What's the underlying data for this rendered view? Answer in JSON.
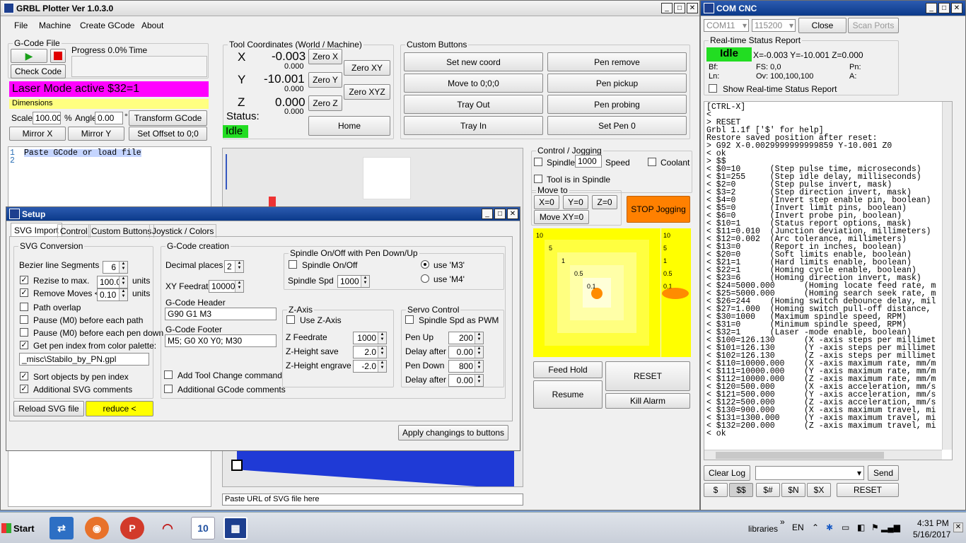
{
  "main": {
    "title": "GRBL Plotter Ver 1.0.3.0",
    "menu": [
      "File",
      "Machine",
      "Create GCode",
      "About"
    ],
    "gcode_file": {
      "label": "G-Code File",
      "progress": "Progress 0.0%",
      "time": "Time",
      "check_code": "Check Code"
    },
    "laser_mode": "Laser Mode active $32=1",
    "dimensions": "Dimensions",
    "scale_label": "Scale",
    "scale_value": "100.00",
    "percent": "%",
    "angle_label": "Angle",
    "angle_value": "0.00",
    "degree": "°",
    "transform": "Transform GCode",
    "mirror_x": "Mirror X",
    "mirror_y": "Mirror Y",
    "set_offset": "Set Offset to 0;0",
    "editor_line1": "Paste GCode or load file",
    "line_nums": [
      "1",
      "2"
    ],
    "tool_coords": {
      "label": "Tool Coordinates (World / Machine)",
      "x": "X",
      "x_world": "-0.003",
      "x_machine": "0.000",
      "y": "Y",
      "y_world": "-10.001",
      "y_machine": "0.000",
      "z": "Z",
      "z_world": "0.000",
      "z_machine": "0.000",
      "status_label": "Status:",
      "status": "Idle",
      "zero_x": "Zero X",
      "zero_y": "Zero Y",
      "zero_z": "Zero Z",
      "zero_xy": "Zero XY",
      "zero_xyz": "Zero XYZ",
      "home": "Home"
    },
    "custom_buttons": {
      "label": "Custom Buttons",
      "buttons": [
        "Set new coord",
        "Pen remove",
        "Move to 0;0;0",
        "Pen pickup",
        "Tray Out",
        "Pen probing",
        "Tray In",
        "Set Pen 0"
      ]
    },
    "control": {
      "label": "Control / Jogging",
      "spindle": "Spindle",
      "speed_value": "1000",
      "speed_label": "Speed",
      "coolant": "Coolant",
      "tool_in_spindle": "Tool is in Spindle",
      "move_to": "Move to",
      "x0": "X=0",
      "y0": "Y=0",
      "z0": "Z=0",
      "move_xy0": "Move XY=0",
      "stop_jogging": "STOP Jogging"
    },
    "jog_labels": [
      "10",
      "5",
      "1",
      "0.5",
      "0.1"
    ],
    "jog_z_labels": [
      "10",
      "5",
      "1",
      "0.5",
      "0.1"
    ],
    "feed_hold": "Feed Hold",
    "resume": "Resume",
    "reset": "RESET",
    "kill_alarm": "Kill Alarm",
    "url_placeholder": "Paste URL of SVG file here"
  },
  "setup": {
    "title": "Setup",
    "tabs": [
      "SVG Import",
      "Control",
      "Custom Buttons",
      "Joystick / Colors"
    ],
    "svg_conversion": "SVG Conversion",
    "bezier": "Bezier line Segments",
    "bezier_value": "6",
    "resize": "Rezise to max.",
    "resize_value": "100.0",
    "units": "units",
    "remove_moves": "Remove Moves <",
    "remove_value": "0.10",
    "path_overlap": "Path overlap",
    "pause_path": "Pause (M0) before each path",
    "pause_pen": "Pause (M0) before each pen down",
    "pen_index": "Get pen index from color palette:",
    "palette_file": "_misc\\Stabilo_by_PN.gpl",
    "sort": "Sort objects by pen index",
    "additional_svg": "Additional SVG comments",
    "gcode_creation": "G-Code creation",
    "decimal": "Decimal places",
    "decimal_value": "2",
    "xy_feed": "XY Feedrate",
    "xy_feed_value": "10000",
    "header_label": "G-Code Header",
    "header_value": "G90 G1 M3",
    "footer_label": "G-Code Footer",
    "footer_value": "M5; G0 X0 Y0; M30",
    "tool_change": "Add Tool Change command",
    "additional_gcode": "Additional GCode comments",
    "spindle_onoff_group": "Spindle On/Off with Pen Down/Up",
    "spindle_onoff": "Spindle On/Off",
    "spindle_spd": "Spindle Spd",
    "spindle_spd_value": "1000",
    "use_m3": "use 'M3'",
    "use_m4": "use 'M4'",
    "z_axis": "Z-Axis",
    "use_z": "Use Z-Axis",
    "z_feed": "Z Feedrate",
    "z_feed_value": "1000",
    "z_save": "Z-Height save",
    "z_save_value": "2.0",
    "z_engrave": "Z-Height engrave",
    "z_engrave_value": "-2.0",
    "servo": "Servo Control",
    "spindle_pwm": "Spindle Spd as PWM",
    "pen_up": "Pen Up",
    "pen_up_value": "200",
    "delay1": "Delay after",
    "delay1_value": "0.00",
    "pen_down": "Pen Down",
    "pen_down_value": "800",
    "delay2": "Delay after",
    "delay2_value": "0.00",
    "reload": "Reload SVG file",
    "reduce": "reduce <",
    "apply": "Apply changings to buttons"
  },
  "com": {
    "title": "COM CNC",
    "port": "COM11",
    "baud": "115200",
    "close": "Close",
    "scan": "Scan Ports",
    "rt_label": "Real-time Status Report",
    "state": "Idle",
    "pos": "X=-0.003 Y=-10.001 Z=0.000",
    "bf": "Bf:",
    "fs": "FS:  0,0",
    "pn": "Pn:",
    "ln": "Ln:",
    "ov": "Ov:  100,100,100",
    "a": "A:",
    "show_rt": "Show Real-time Status Report",
    "log": [
      "[CTRL-X]",
      "<",
      "> RESET",
      "Grbl 1.1f ['$' for help]",
      "Restore saved position after reset:",
      "> G92 X-0.0029999999999859 Y-10.001 Z0",
      "< ok",
      "> $$",
      "< $0=10      (Step pulse time, microseconds)",
      "< $1=255     (Step idle delay, milliseconds)",
      "< $2=0       (Step pulse invert, mask)",
      "< $3=2       (Step direction invert, mask)",
      "< $4=0       (Invert step enable pin, boolean)",
      "< $5=0       (Invert limit pins, boolean)",
      "< $6=0       (Invert probe pin, boolean)",
      "< $10=1      (Status report options, mask)",
      "< $11=0.010  (Junction deviation, millimeters)",
      "< $12=0.002  (Arc tolerance, millimeters)",
      "< $13=0      (Report in inches, boolean)",
      "< $20=0      (Soft limits enable, boolean)",
      "< $21=1      (Hard limits enable, boolean)",
      "< $22=1      (Homing cycle enable, boolean)",
      "< $23=6      (Homing direction invert, mask)",
      "< $24=5000.000      (Homing locate feed rate, m",
      "< $25=5000.000      (Homing search seek rate, m",
      "< $26=244    (Homing switch debounce delay, mil",
      "< $27=1.000  (Homing switch pull-off distance,",
      "< $30=1000   (Maximum spindle speed, RPM)",
      "< $31=0      (Minimum spindle speed, RPM)",
      "< $32=1      (Laser -mode enable, boolean)",
      "< $100=126.130      (X -axis steps per millimet",
      "< $101=126.130      (Y -axis steps per millimet",
      "< $102=126.130      (Z -axis steps per millimet",
      "< $110=10000.000    (X -axis maximum rate, mm/m",
      "< $111=10000.000    (Y -axis maximum rate, mm/m",
      "< $112=10000.000    (Z -axis maximum rate, mm/m",
      "< $120=500.000      (X -axis acceleration, mm/s",
      "< $121=500.000      (Y -axis acceleration, mm/s",
      "< $122=500.000      (Z -axis acceleration, mm/s",
      "< $130=900.000      (X -axis maximum travel, mi",
      "< $131=1300.000     (Y -axis maximum travel, mi",
      "< $132=200.000      (Z -axis maximum travel, mi",
      "< ok"
    ],
    "clear_log": "Clear Log",
    "send": "Send",
    "cmds": [
      "$",
      "$$",
      "$#",
      "$N",
      "$X"
    ],
    "reset": "RESET"
  },
  "taskbar": {
    "start": "Start",
    "libraries": "libraries",
    "lang": "EN",
    "time": "4:31 PM",
    "date": "5/16/2017",
    "wb": "10"
  }
}
